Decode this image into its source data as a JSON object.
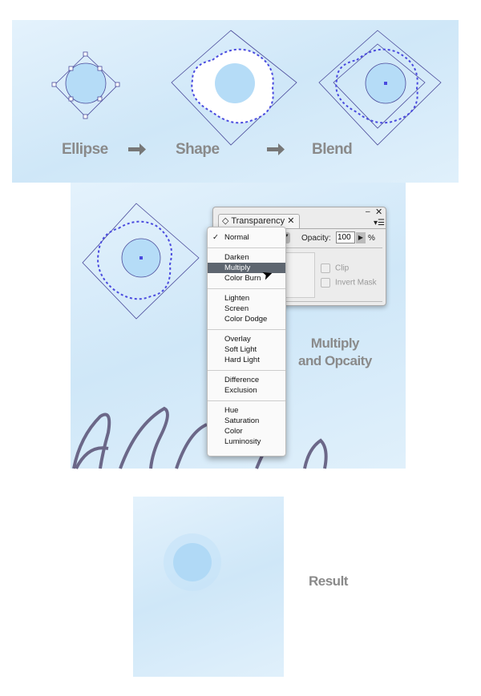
{
  "steps": {
    "ellipse": "Ellipse",
    "shape": "Shape",
    "blend": "Blend"
  },
  "caption": {
    "line1": "Multiply",
    "line2": "and Opcaity"
  },
  "result_label": "Result",
  "panel": {
    "title": "Transparency",
    "opacity_label": "Opacity:",
    "opacity_value": "100",
    "percent": "%",
    "clip": "Clip",
    "invert_mask": "Invert Mask"
  },
  "blend_menu": {
    "checked": "Normal",
    "groups": [
      [
        "Normal"
      ],
      [
        "Darken",
        "Multiply",
        "Color Burn"
      ],
      [
        "Lighten",
        "Screen",
        "Color Dodge"
      ],
      [
        "Overlay",
        "Soft Light",
        "Hard Light"
      ],
      [
        "Difference",
        "Exclusion"
      ],
      [
        "Hue",
        "Saturation",
        "Color",
        "Luminosity"
      ]
    ],
    "highlighted": "Multiply"
  },
  "colors": {
    "sky": "#d3e9f8",
    "circle": "#b5dcf7",
    "anchor": "#4a4adf",
    "outline": "#6b6788",
    "menu_highlight": "#5e6670"
  }
}
